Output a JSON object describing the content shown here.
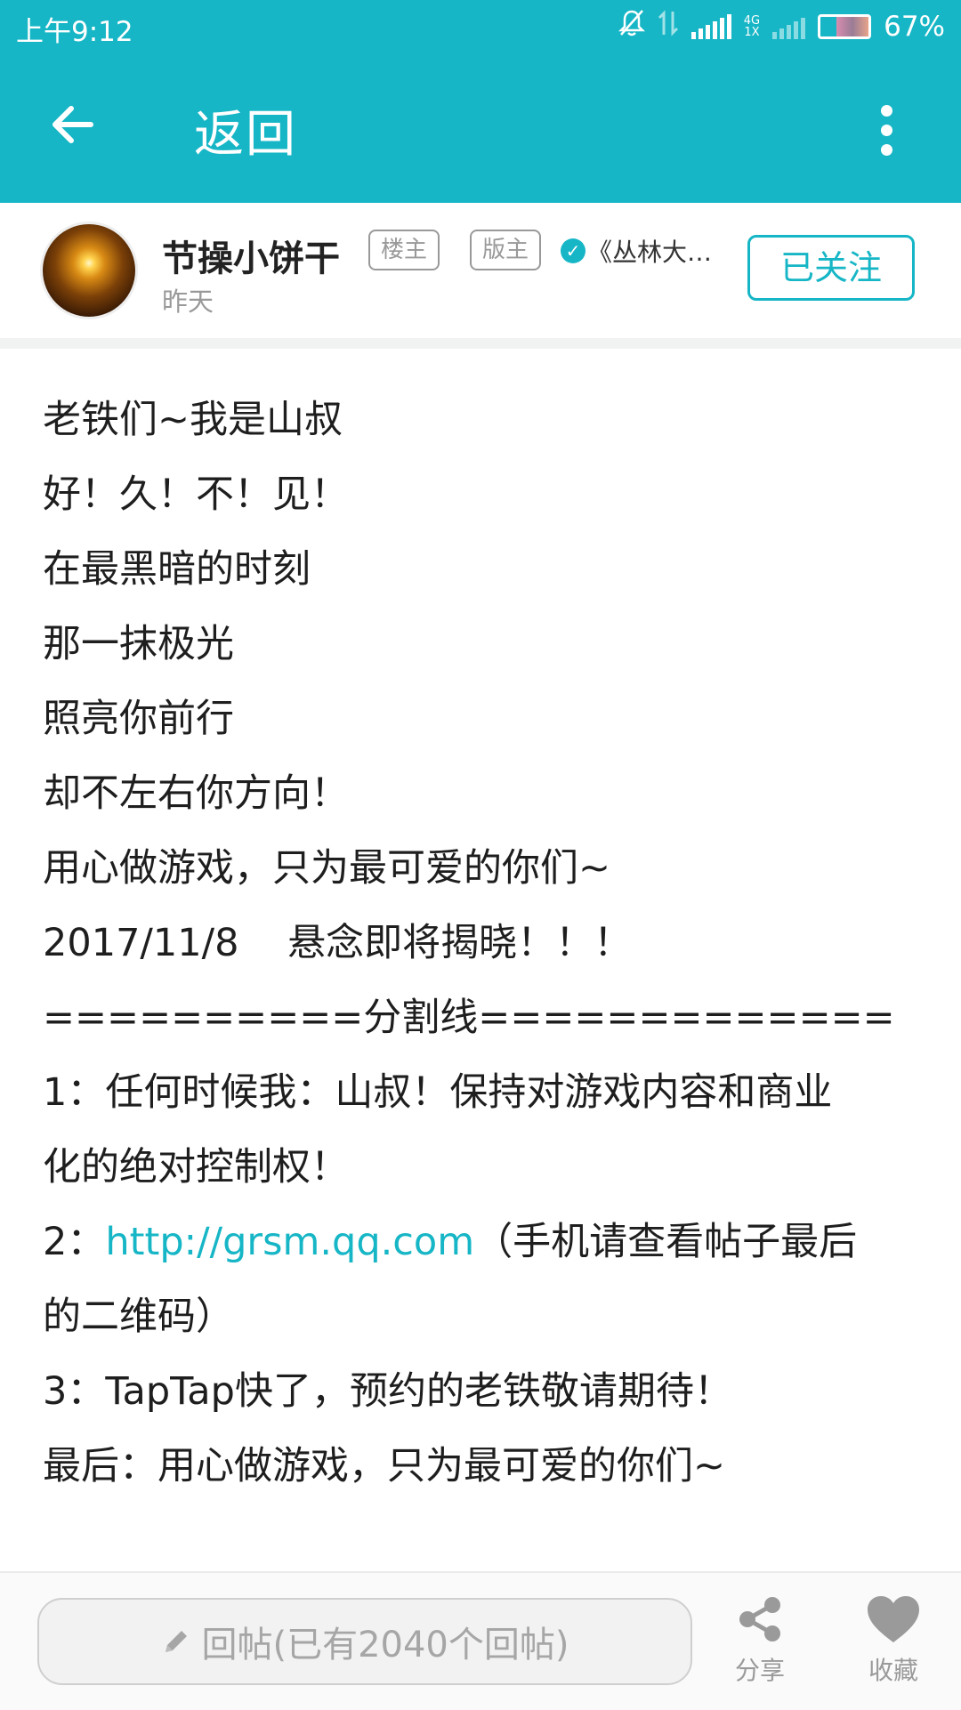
{
  "status_bar": {
    "time": "上午9:12",
    "battery": "67%",
    "battery_level": 0.67,
    "network": "4G"
  },
  "header": {
    "title": "返回",
    "back_icon": "arrow-left-icon",
    "more_icon": "more-vertical-icon",
    "color": "#16b6c6"
  },
  "author": {
    "name": "节操小饼干",
    "tags": [
      "楼主",
      "版主"
    ],
    "verified_icon": "check-badge-icon",
    "forum": "《丛林大逃…",
    "time": "昨天",
    "follow_label": "已关注"
  },
  "post": {
    "lines": [
      "老铁们~我是山叔",
      "好！久！不！见！",
      "在最黑暗的时刻",
      "那一抹极光",
      "照亮你前行",
      "却不左右你方向！",
      "用心做游戏，只为最可爱的你们~",
      "2017/11/8    悬念即将揭晓！！！",
      "==========分割线=============",
      "1：任何时候我：山叔！保持对游戏内容和商业",
      "化的绝对控制权！"
    ],
    "line2_prefix": "2：",
    "link": "http://grsm.qq.com",
    "line2_suffix": "（手机请查看帖子最后",
    "line2_cont": "的二维码）",
    "line3": "3：TapTap快了，预约的老铁敬请期待！",
    "line4": "最后：用心做游戏，只为最可爱的你们~"
  },
  "bottom": {
    "reply_placeholder": "回帖(已有2040个回帖)",
    "share_label": "分享",
    "favorite_label": "收藏",
    "icons": [
      "pencil-icon",
      "share-icon",
      "heart-icon"
    ]
  }
}
